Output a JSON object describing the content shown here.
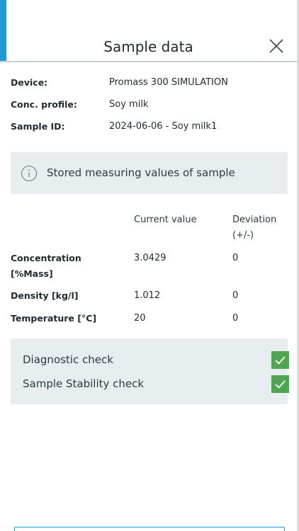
{
  "header": {
    "title": "Sample data"
  },
  "info": [
    {
      "label": "Device:",
      "value": "Promass 300 SIMULATION"
    },
    {
      "label": "Conc. profile:",
      "value": "Soy milk"
    },
    {
      "label": "Sample ID:",
      "value": "2024-06-06 - Soy milk1"
    }
  ],
  "notice": {
    "icon": "info-icon",
    "text": "Stored measuring values of sample"
  },
  "table": {
    "col_current": "Current value",
    "col_deviation_line1": "Deviation",
    "col_deviation_line2": "(+/-)",
    "rows": [
      {
        "label_line1": "Concentration",
        "label_line2": "[%Mass]",
        "current": "3.0429",
        "deviation": "0"
      },
      {
        "label_line1": "Density [kg/l]",
        "label_line2": "",
        "current": "1.012",
        "deviation": "0"
      },
      {
        "label_line1": "Temperature [°C]",
        "label_line2": "",
        "current": "20",
        "deviation": "0"
      }
    ]
  },
  "checks": [
    {
      "label": "Diagnostic check",
      "checked": true
    },
    {
      "label": "Sample Stability check",
      "checked": true
    }
  ],
  "colors": {
    "accent": "#1e9ad6",
    "check_green": "#4ea651",
    "panel_bg": "#e8edf0"
  }
}
